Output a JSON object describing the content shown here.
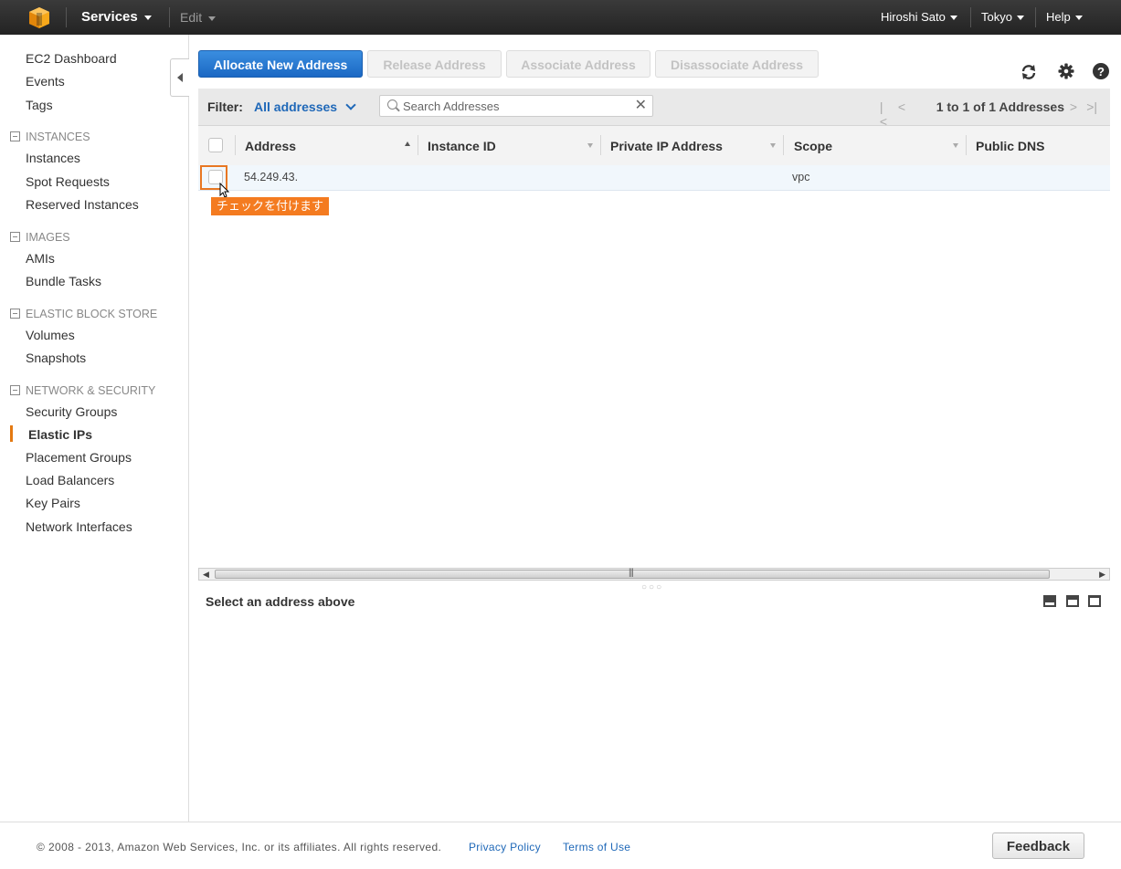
{
  "topbar": {
    "logo_icon": "aws-cube-icon",
    "services": "Services",
    "edit": "Edit",
    "user": "Hiroshi Sato",
    "region": "Tokyo",
    "help": "Help"
  },
  "sidebar": {
    "top_links": [
      "EC2 Dashboard",
      "Events",
      "Tags"
    ],
    "sections": [
      {
        "title": "INSTANCES",
        "items": [
          "Instances",
          "Spot Requests",
          "Reserved Instances"
        ]
      },
      {
        "title": "IMAGES",
        "items": [
          "AMIs",
          "Bundle Tasks"
        ]
      },
      {
        "title": "ELASTIC BLOCK STORE",
        "items": [
          "Volumes",
          "Snapshots"
        ]
      },
      {
        "title": "NETWORK & SECURITY",
        "items": [
          "Security Groups",
          "Elastic IPs",
          "Placement Groups",
          "Load Balancers",
          "Key Pairs",
          "Network Interfaces"
        ]
      }
    ],
    "active_item": "Elastic IPs",
    "active_color": "#e47911"
  },
  "actions": {
    "allocate": "Allocate New Address",
    "release": "Release Address",
    "associate": "Associate Address",
    "disassociate": "Disassociate Address"
  },
  "filter": {
    "label": "Filter:",
    "value": "All addresses",
    "search_placeholder": "Search Addresses",
    "pager_text": "1 to 1 of 1 Addresses"
  },
  "table": {
    "columns": [
      "Address",
      "Instance ID",
      "Private IP Address",
      "Scope",
      "Public DNS"
    ],
    "rows": [
      {
        "address": "54.249.43.",
        "instance_id": "",
        "private_ip": "",
        "scope": "vpc",
        "public_dns": ""
      }
    ]
  },
  "annotation": {
    "callout": "チェックを付けます",
    "color": "#f47b20"
  },
  "detail": {
    "message": "Select an address above"
  },
  "footer": {
    "copyright": "© 2008 - 2013, Amazon Web Services, Inc. or its affiliates. All rights reserved.",
    "privacy": "Privacy Policy",
    "terms": "Terms of Use",
    "feedback": "Feedback"
  },
  "colors": {
    "primary_button": "#1b68c4",
    "link": "#1f68b8"
  }
}
